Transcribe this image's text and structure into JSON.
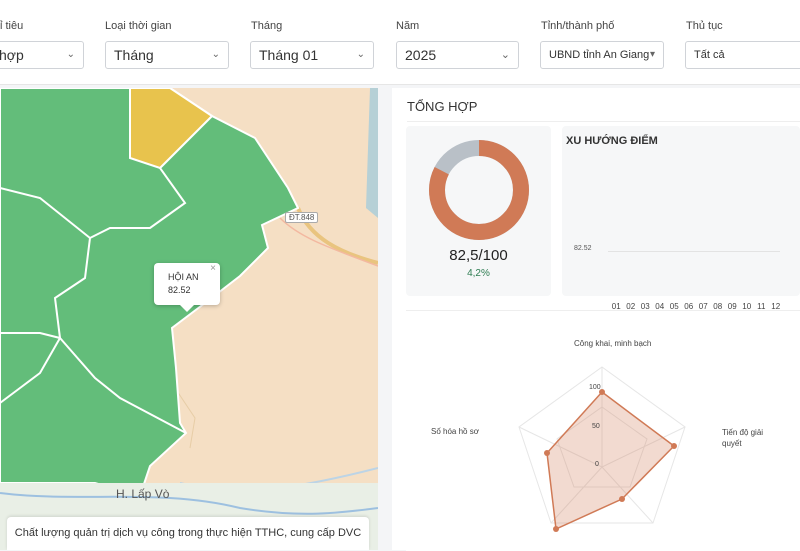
{
  "filters": [
    {
      "label": "ỉ tiêu",
      "value": "hợp"
    },
    {
      "label": "Loại thời gian",
      "value": "Tháng"
    },
    {
      "label": "Tháng",
      "value": "Tháng 01"
    },
    {
      "label": "Năm",
      "value": "2025"
    },
    {
      "label": "Tỉnh/thành phố",
      "value": "UBND tỉnh An Giang"
    },
    {
      "label": "Thủ tục",
      "value": "Tất cả"
    }
  ],
  "map": {
    "tooltip_name": "HỘI AN",
    "tooltip_value": "82.52",
    "town_label": "H. Lấp Vò",
    "road_badge": "ĐT.848",
    "caption": "Chất lượng quản trị dịch vụ công trong thực hiện TTHC, cung cấp DVC",
    "colors": {
      "green": "#63bd7a",
      "yellow": "#e8c34d",
      "peach": "#f5dfc4"
    }
  },
  "summary": {
    "title": "TỔNG HỢP",
    "score": "82,5/100",
    "change": "4,2%",
    "donut": {
      "value": 82.5,
      "max": 100,
      "fill": "#d07a56",
      "rest": "#b9c0c7"
    },
    "trend": {
      "title": "XU HƯỚNG ĐIỂM",
      "y_label": "82.52",
      "months": [
        "01",
        "02",
        "03",
        "04",
        "05",
        "06",
        "07",
        "08",
        "09",
        "10",
        "11",
        "12"
      ]
    },
    "radar": {
      "axes": [
        "Công khai, minh bạch",
        "Tiến độ giải quyết",
        "Số hóa hồ sơ"
      ],
      "ticks": [
        "100",
        "50",
        "0"
      ],
      "color": "#d07a56"
    }
  }
}
